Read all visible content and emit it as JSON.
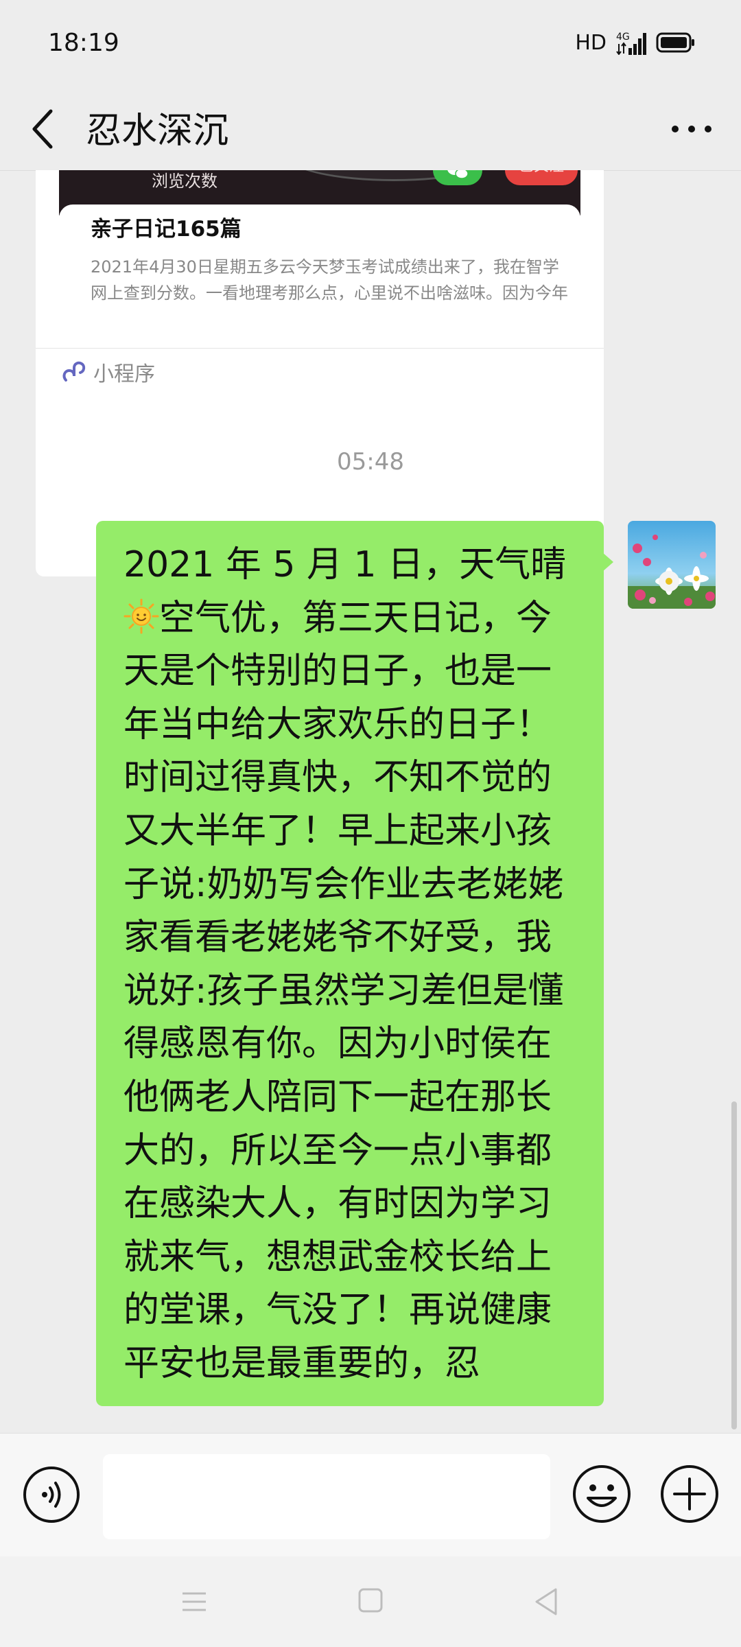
{
  "status_bar": {
    "time": "18:19",
    "hd_label": "HD",
    "network_label": "4G"
  },
  "header": {
    "title": "忍水深沉",
    "back_icon": "chevron-left-icon",
    "more_icon": "more-horizontal-icon"
  },
  "mini_program_card": {
    "banner_views_label": "浏览次数",
    "banner_follow_label": "已关注",
    "title": "亲子日记165篇",
    "description": "2021年4月30日星期五多云今天梦玉考试成绩出来了，我在智学网上查到分数。一看地理考那么点，心里说不出啥滋味。因为今年",
    "footer_label": "小程序",
    "footer_icon": "mini-program-icon"
  },
  "timestamp": "05:48",
  "message": {
    "text_before_emoji": "2021 年 5 月 1 日，天气晴",
    "emoji": "sun-emoji",
    "text_after_emoji": "空气优，第三天日记，今天是个特别的日子，也是一年当中给大家欢乐的日子！时间过得真快，不知不觉的又大半年了！早上起来小孩子说:奶奶写会作业去老姥姥家看看老姥姥爷不好受，我说好:孩子虽然学习差但是懂得感恩有你。因为小时侯在他俩老人陪同下一起在那长大的，所以至今一点小事都在感染大人，有时因为学习就来气，想想武金校长给上的堂课，气没了！再说健康平安也是最重要的，忍",
    "bubble_color": "#95ec69"
  },
  "input_bar": {
    "value": "",
    "voice_icon": "voice-icon",
    "emoji_icon": "emoji-smile-icon",
    "plus_icon": "plus-circle-icon"
  },
  "nav_bar": {
    "menu_icon": "menu-icon",
    "home_icon": "home-square-icon",
    "back_icon": "back-triangle-icon"
  },
  "colors": {
    "background": "#ededed",
    "bubble": "#95ec69",
    "follow_badge": "#e64340",
    "wechat_badge": "#3bbf4a"
  }
}
